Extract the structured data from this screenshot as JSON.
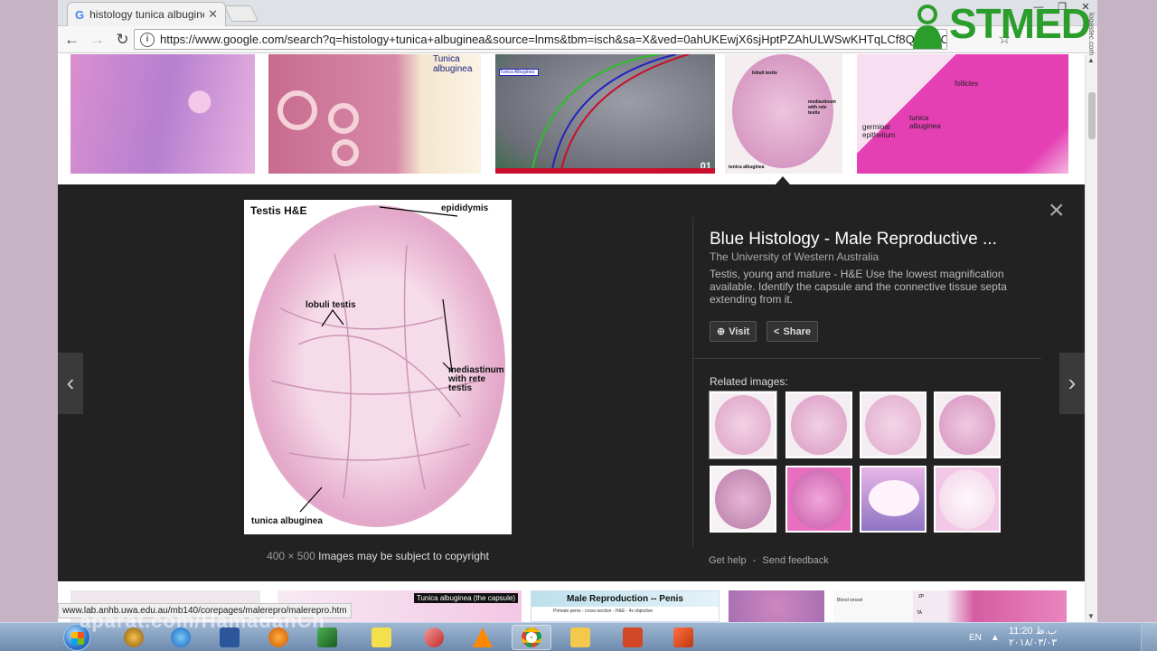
{
  "browser": {
    "tab_title": "histology tunica albugine",
    "tab_favicon": "G",
    "url": "https://www.google.com/search?q=histology+tunica+albuginea&source=lnms&tbm=isch&sa=X&ved=0ahUKEwjX6sjHptPZAhULWSwKHTqLCf8Q_AUICi",
    "status_url": "www.lab.anhb.uwa.edu.au/mb140/corepages/malerepro/malerepro.htm"
  },
  "thumbs_top": {
    "t2_label": "Tunica albuginea",
    "t3_tag": "Tunica Albuginea",
    "t3_number": "01",
    "t4_labels": [
      "lobuli testis",
      "mediastinum with rete testis",
      "tunica albuginea"
    ],
    "t5_labels": [
      "follicles",
      "germinal epithelium",
      "tunica albuginea"
    ]
  },
  "preview": {
    "image_labels": {
      "title": "Testis  H&E",
      "epididymis": "epididymis",
      "lobuli": "lobuli testis",
      "mediastinum": "mediastinum with rete testis",
      "tunica": "tunica albuginea"
    },
    "dimensions": "400 × 500",
    "copyright": "Images may be subject to copyright",
    "title": "Blue Histology - Male Reproductive ...",
    "site": "The University of Western Australia",
    "description": "Testis, young and mature - H&E Use the lowest magnification available. Identify the capsule and the connective tissue septa extending from it.",
    "visit_label": "Visit",
    "share_label": "Share",
    "related_title": "Related images:",
    "get_help": "Get help",
    "separator": "-",
    "send_feedback": "Send feedback",
    "close_symbol": "×",
    "prev_symbol": "‹",
    "next_symbol": "›"
  },
  "thumbs_bottom": {
    "b2_label": "Tunica albuginea (the capsule)",
    "b3_title": "Male Reproduction -- Penis",
    "b3_sub": "Primate penis - cross-section - H&E - 4x objective",
    "b5_label": "Blood vessel",
    "b6_labels": [
      "ZP",
      "TA"
    ]
  },
  "watermarks": {
    "aparat": "aparat.com/HamadanCh",
    "logo": "STMED",
    "side_text": "logastec.com"
  },
  "taskbar": {
    "lang": "EN",
    "time": "11:20 ب.ظ",
    "date": "۲۰۱۸/۰۳/۰۳"
  },
  "colors": {
    "preview_bg": "#222222",
    "logo_green": "#2a9d2a",
    "accent_blue": "#4285f4"
  }
}
